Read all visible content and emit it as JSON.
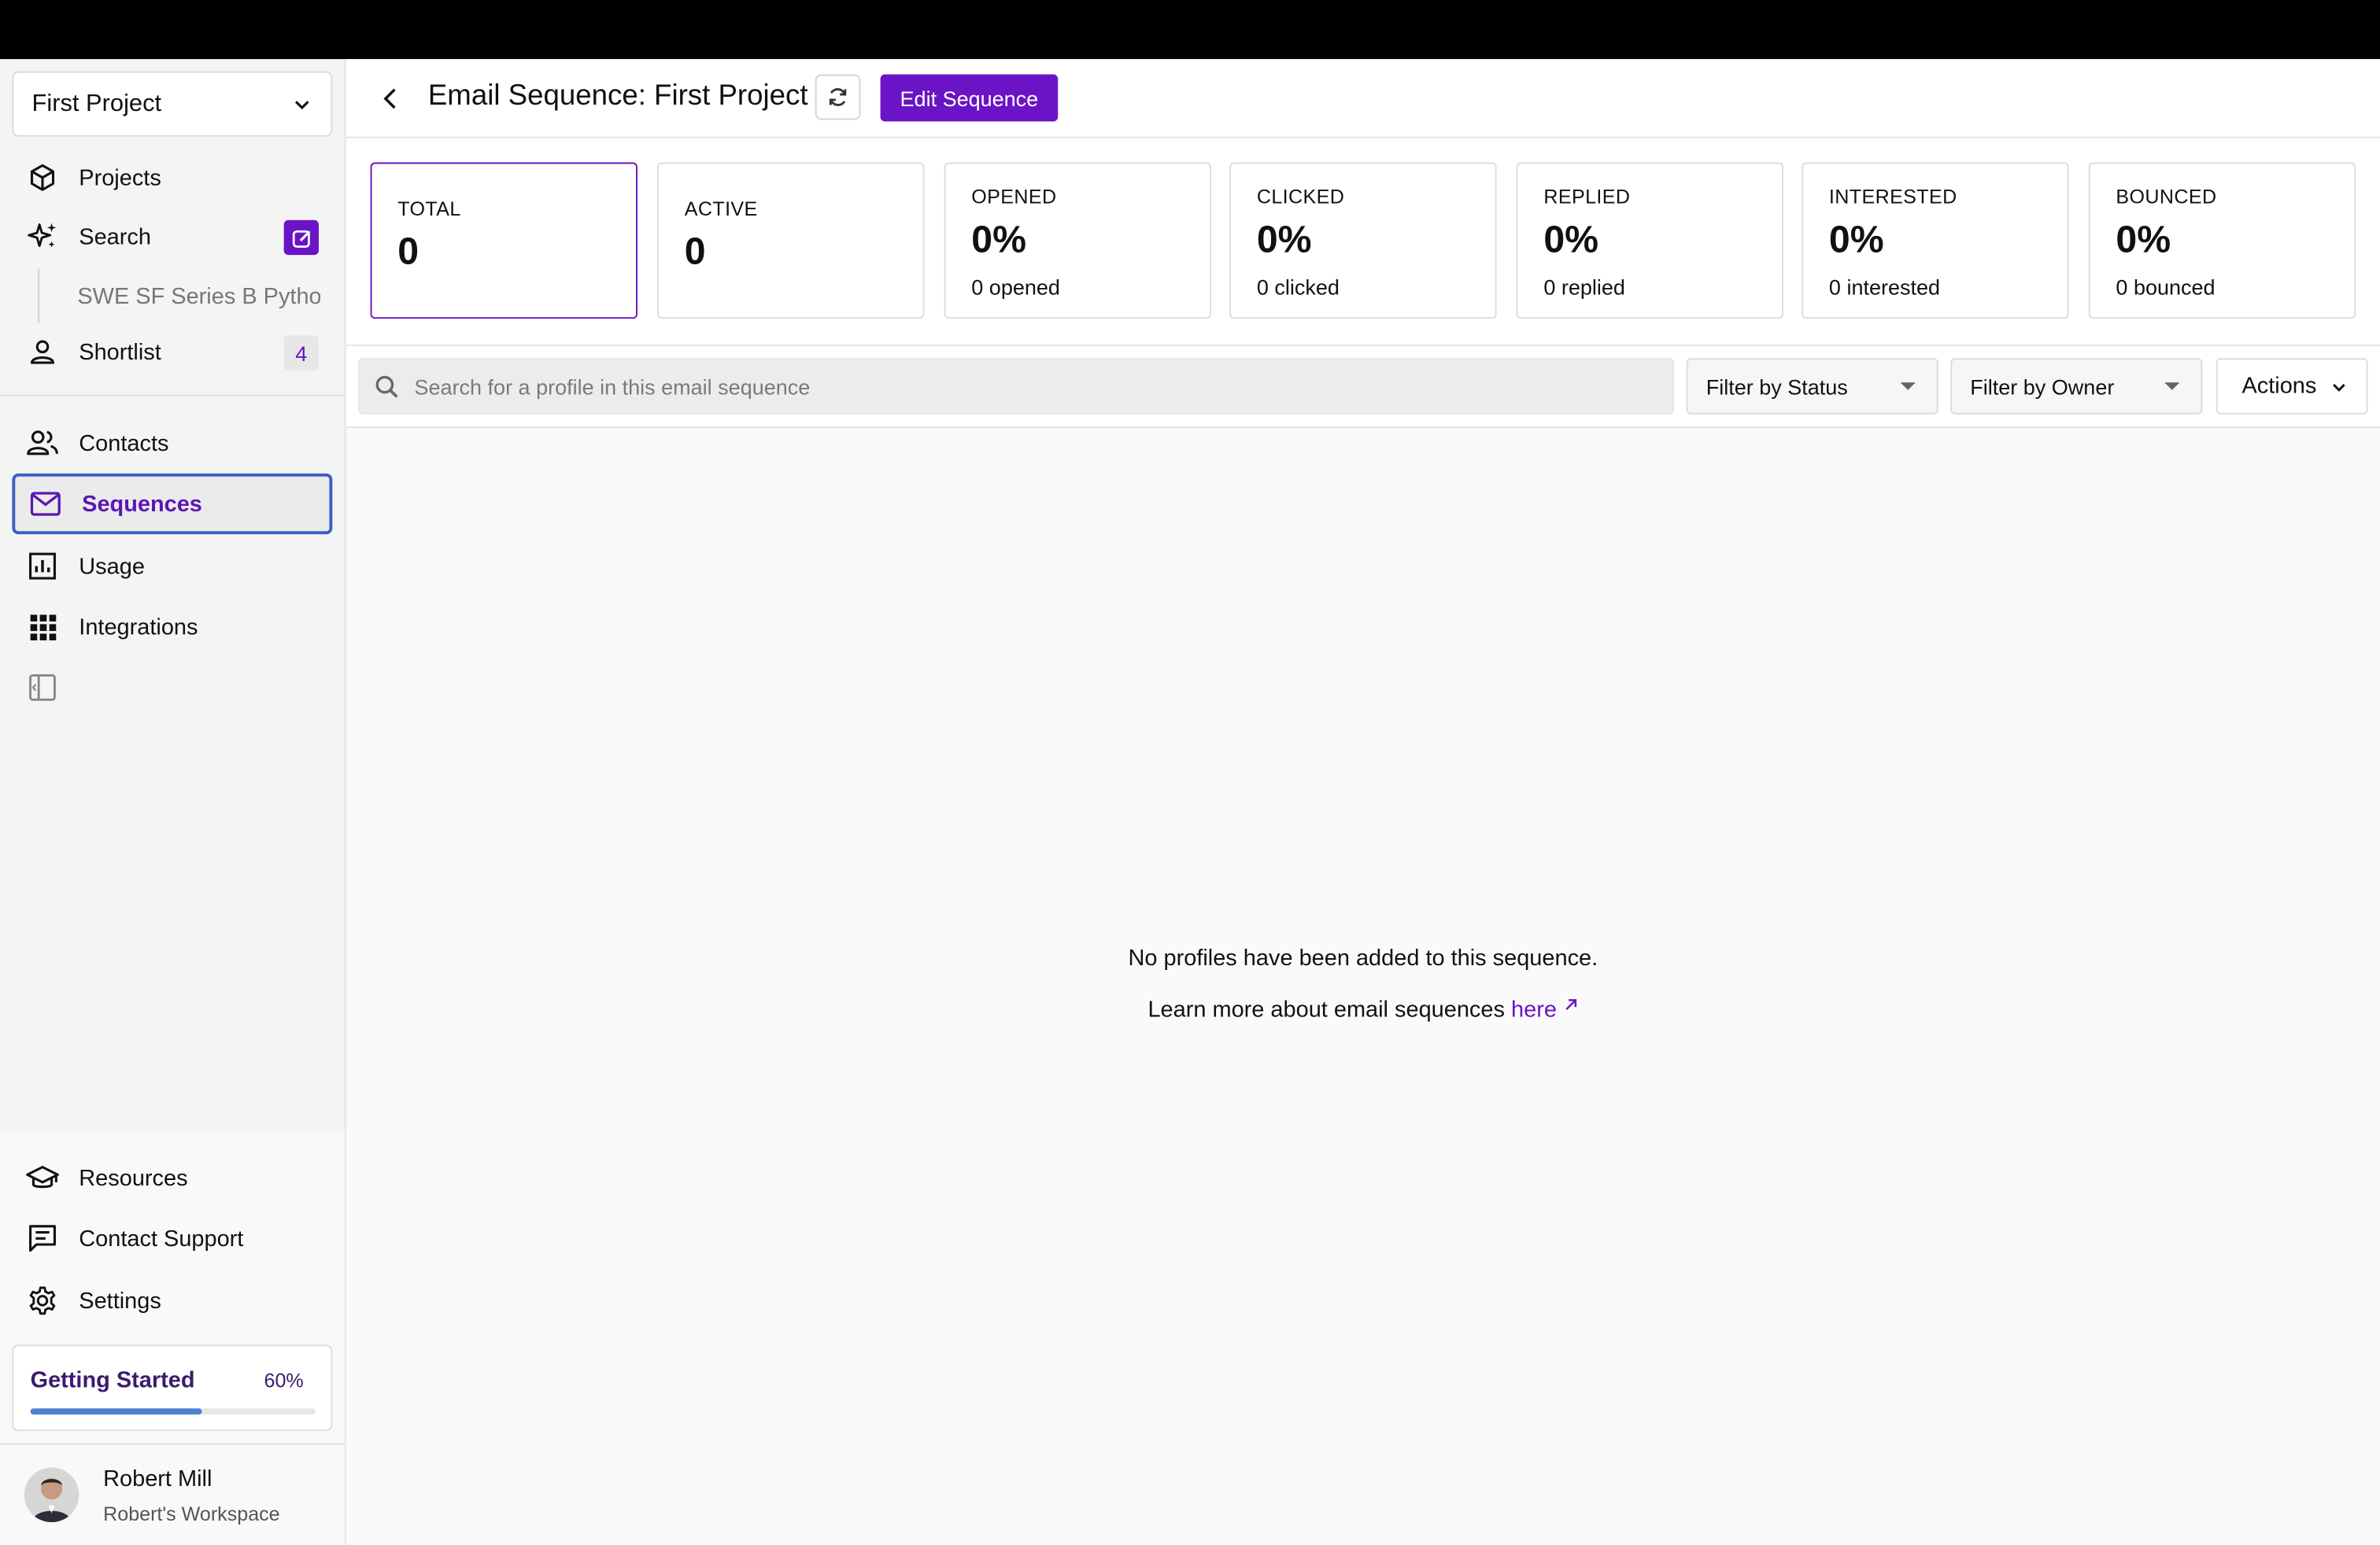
{
  "sidebar": {
    "project_select": "First Project",
    "nav": {
      "projects": "Projects",
      "search": "Search",
      "search_sub": "SWE SF Series B Python",
      "shortlist": "Shortlist",
      "shortlist_count": "4",
      "contacts": "Contacts",
      "sequences": "Sequences",
      "usage": "Usage",
      "integrations": "Integrations"
    },
    "bottom": {
      "resources": "Resources",
      "contact_support": "Contact Support",
      "settings": "Settings"
    },
    "getting_started": {
      "label": "Getting Started",
      "percent_text": "60%",
      "progress": 0.6
    },
    "user": {
      "name": "Robert Mill",
      "workspace": "Robert's Workspace"
    }
  },
  "header": {
    "title": "Email Sequence: First Project",
    "edit_button": "Edit Sequence"
  },
  "stats": [
    {
      "label": "TOTAL",
      "value": "0",
      "sub": ""
    },
    {
      "label": "ACTIVE",
      "value": "0",
      "sub": ""
    },
    {
      "label": "OPENED",
      "value": "0%",
      "sub": "0 opened"
    },
    {
      "label": "CLICKED",
      "value": "0%",
      "sub": "0 clicked"
    },
    {
      "label": "REPLIED",
      "value": "0%",
      "sub": "0 replied"
    },
    {
      "label": "INTERESTED",
      "value": "0%",
      "sub": "0 interested"
    },
    {
      "label": "BOUNCED",
      "value": "0%",
      "sub": "0 bounced"
    }
  ],
  "filters": {
    "search_placeholder": "Search for a profile in this email sequence",
    "status": "Filter by Status",
    "owner": "Filter by Owner",
    "actions": "Actions"
  },
  "empty": {
    "message": "No profiles have been added to this sequence.",
    "learn_prefix": "Learn more about email sequences",
    "learn_link": "here"
  },
  "colors": {
    "accent": "#6a14c6",
    "progress": "#4f7fd3",
    "active_border": "#3a5fc4"
  }
}
